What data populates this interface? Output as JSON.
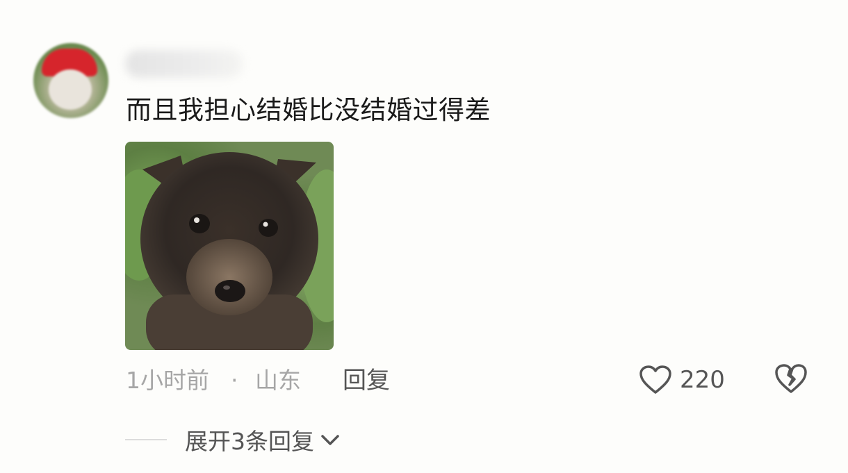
{
  "comment": {
    "text": "而且我担心结婚比没结婚过得差",
    "time": "1小时前",
    "separator": "·",
    "region": "山东",
    "reply_label": "回复",
    "like_count": "220",
    "expand_label": "展开3条回复"
  },
  "icons": {
    "like": "heart-outline-icon",
    "dislike": "broken-heart-icon",
    "expand": "chevron-down-icon"
  },
  "colors": {
    "text_primary": "#1a1a1a",
    "text_secondary": "#555555",
    "text_muted": "#a6a6a6"
  }
}
